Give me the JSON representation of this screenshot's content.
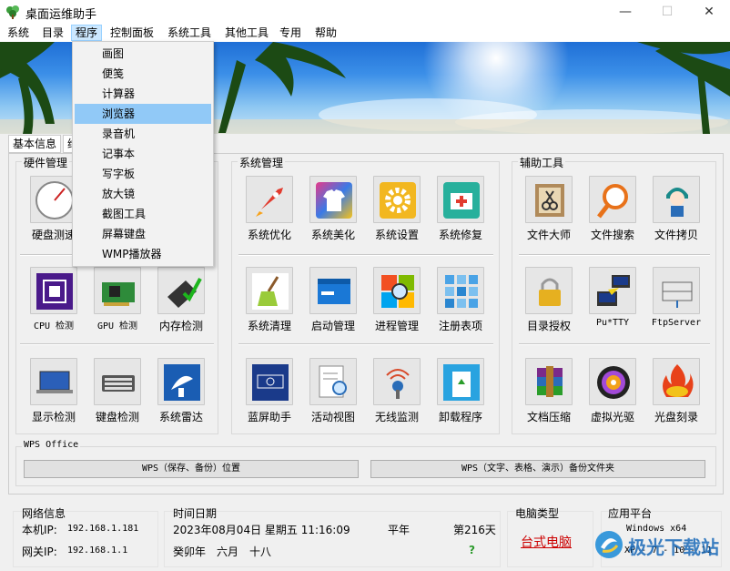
{
  "window": {
    "title": "桌面运维助手",
    "min": "—",
    "max": "☐",
    "close": "✕"
  },
  "menu": [
    "系统",
    "目录",
    "程序",
    "控制面板",
    "系统工具",
    "其他工具",
    "专用",
    "帮助"
  ],
  "dropdown": [
    "画图",
    "便笺",
    "计算器",
    "浏览器",
    "录音机",
    "记事本",
    "写字板",
    "放大镜",
    "截图工具",
    "屏幕键盘",
    "WMP播放器"
  ],
  "tabs": [
    "基本信息",
    "维"
  ],
  "groups": {
    "hardware": "硬件管理",
    "system": "系统管理",
    "aux": "辅助工具",
    "wps": "WPS Office"
  },
  "hardware_tools": [
    "硬盘测速",
    "",
    "",
    "CPU 检测",
    "GPU 检测",
    "内存检测",
    "显示检测",
    "键盘检测",
    "系统雷达"
  ],
  "system_tools": [
    "系统优化",
    "系统美化",
    "系统设置",
    "系统修复",
    "系统清理",
    "启动管理",
    "进程管理",
    "注册表项",
    "蓝屏助手",
    "活动视图",
    "无线监测",
    "卸载程序"
  ],
  "aux_tools": [
    "文件大师",
    "文件搜索",
    "文件拷贝",
    "目录授权",
    "Pu*TTY",
    "FtpServer",
    "文档压缩",
    "虚拟光驱",
    "光盘刻录"
  ],
  "wps_buttons": [
    "WPS（保存、备份）位置",
    "WPS（文字、表格、演示）备份文件夹"
  ],
  "network": {
    "title": "网络信息",
    "ip_label": "本机IP:",
    "ip": "192.168.1.181",
    "gw_label": "网关IP:",
    "gw": "192.168.1.1"
  },
  "datetime": {
    "title": "时间日期",
    "line1": "2023年08月04日 星期五 11:16:09",
    "year_type": "平年",
    "day": "第216天",
    "lunar": "癸卯年　六月　十八",
    "q": "?"
  },
  "pc": {
    "title": "电脑类型",
    "type": "台式电脑"
  },
  "platform": {
    "title": "应用平台",
    "line1": "Windows x64",
    "line2": "XP - 7 - 10 - 11"
  },
  "watermark": "极光下载站",
  "colors": {
    "accent": "#cc0000",
    "menu_hover": "#91c9f7",
    "green_q": "#2b9a2b"
  }
}
